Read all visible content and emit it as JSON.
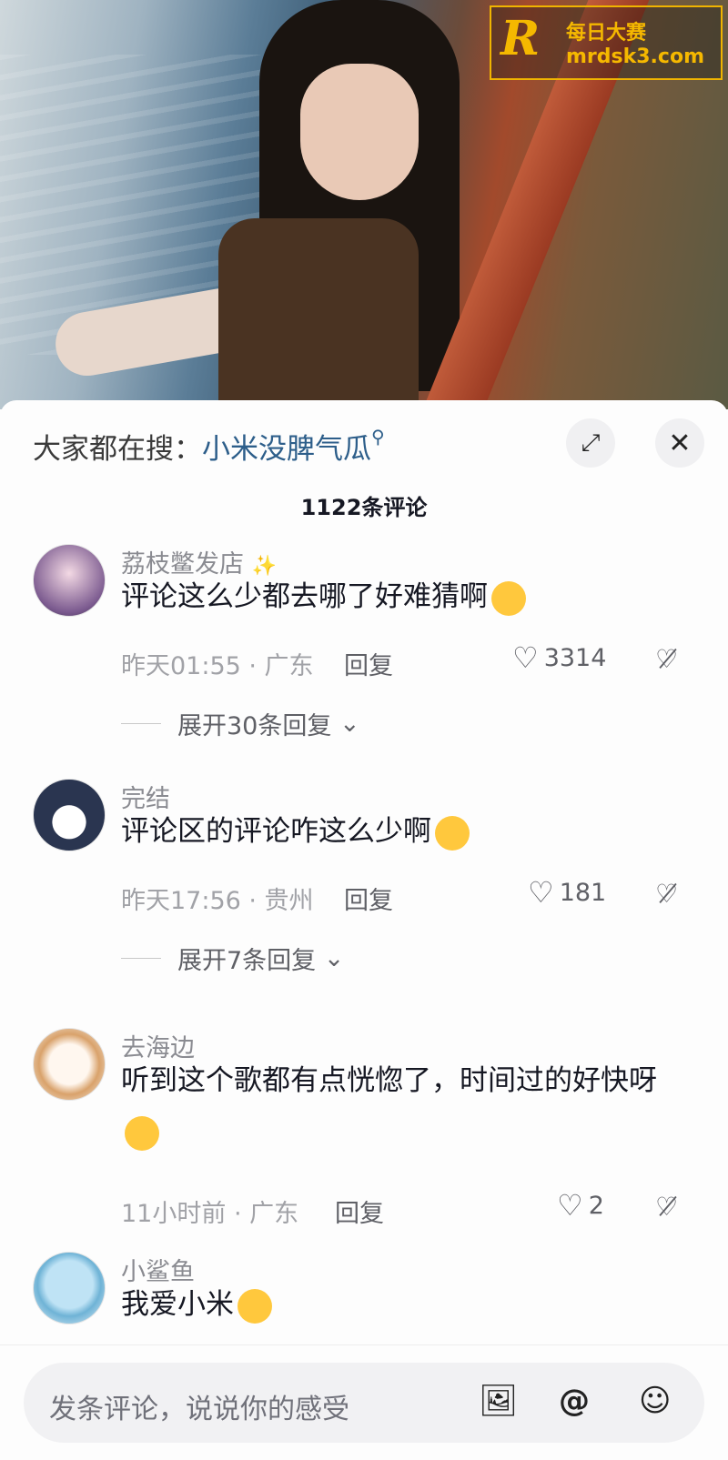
{
  "watermark": {
    "line1": "每日大赛",
    "line2": "mrdsk3.com",
    "letter": "R"
  },
  "search": {
    "prefix": "大家都在搜：",
    "term": "小米没脾气瓜",
    "icon": "search-icon"
  },
  "header": {
    "title": "1122条评论"
  },
  "comments": [
    {
      "name": "荔枝鳖发店",
      "text": "评论这么少都去哪了好难猜啊",
      "time": "昨天01:55 · 广东",
      "reply": "回复",
      "likes": "3314",
      "expand": "展开30条回复"
    },
    {
      "name": "完结",
      "text": "评论区的评论咋这么少啊",
      "time": "昨天17:56 · 贵州",
      "reply": "回复",
      "likes": "181",
      "expand": "展开7条回复"
    },
    {
      "name": "去海边",
      "text": "听到这个歌都有点恍惚了，时间过的好快呀",
      "time": "11小时前 · 广东",
      "reply": "回复",
      "likes": "2"
    },
    {
      "name": "小鲨鱼",
      "text": "我爱小米"
    }
  ],
  "input": {
    "placeholder": "发条评论，说说你的感受"
  },
  "colors": {
    "accent": "#2d5e8a",
    "watermark": "#f5b800"
  }
}
